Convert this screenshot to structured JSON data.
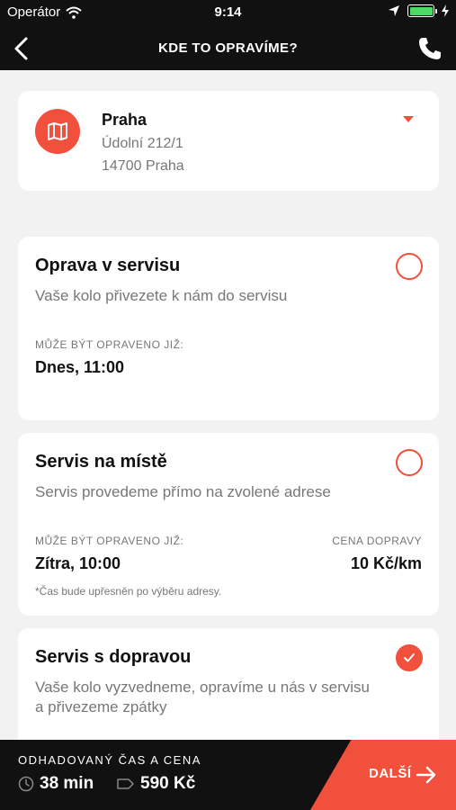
{
  "status_bar": {
    "carrier": "Operátor",
    "time": "9:14"
  },
  "nav": {
    "title": "KDE TO OPRAVÍME?"
  },
  "address": {
    "city": "Praha",
    "street": "Údolní 212/1",
    "zip_city": "14700 Praha"
  },
  "options": [
    {
      "title": "Oprava v servisu",
      "description": "Vaše kolo přivezete k nám do servisu",
      "ready_label": "MŮŽE BÝT OPRAVENO JIŽ:",
      "ready_value": "Dnes, 11:00",
      "selected": false
    },
    {
      "title": "Servis na místě",
      "description": "Servis provedeme přímo na zvolené adrese",
      "ready_label": "MŮŽE BÝT OPRAVENO JIŽ:",
      "ready_value": "Zítra, 10:00",
      "price_label": "CENA DOPRAVY",
      "price_value": "10 Kč/km",
      "note": "*Čas bude upřesněn po výběru adresy.",
      "selected": false
    },
    {
      "title": "Servis s dopravou",
      "description": "Vaše kolo vyzvedneme, opravíme u nás v servisu a přivezeme zpátky",
      "selected": true
    }
  ],
  "footer": {
    "label": "ODHADOVANÝ ČAS A CENA",
    "time_value": "38 min",
    "price_value": "590 Kč",
    "next_label": "DALŠÍ"
  },
  "colors": {
    "accent": "#f0503c",
    "dark": "#111111",
    "background": "#f2f2f2"
  },
  "icons": [
    "wifi-icon",
    "location-arrow-icon",
    "battery-icon",
    "charging-icon",
    "back-chevron-icon",
    "phone-icon",
    "map-icon",
    "dropdown-caret-icon",
    "checkmark-icon",
    "clock-icon",
    "price-tag-icon",
    "arrow-right-icon"
  ]
}
